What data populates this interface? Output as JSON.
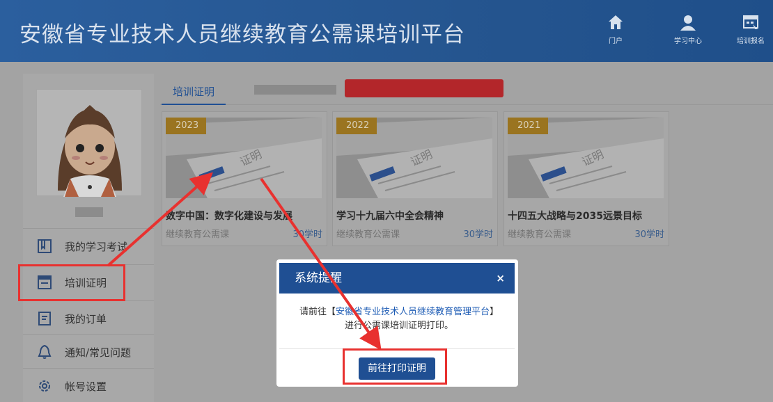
{
  "header": {
    "title": "安徽省专业技术人员继续教育公需课培训平台",
    "nav": [
      {
        "label": "门户",
        "icon": "home-icon"
      },
      {
        "label": "学习中心",
        "icon": "user-icon"
      },
      {
        "label": "培训报名",
        "icon": "signup-icon"
      }
    ]
  },
  "sidebar": {
    "items": [
      {
        "label": "我的学习考试",
        "icon": "book-icon"
      },
      {
        "label": "培训证明",
        "icon": "certificate-icon"
      },
      {
        "label": "我的订单",
        "icon": "order-icon"
      },
      {
        "label": "通知/常见问题",
        "icon": "bell-icon"
      },
      {
        "label": "帐号设置",
        "icon": "gear-icon"
      }
    ]
  },
  "tabs": {
    "active": "培训证明"
  },
  "cards": [
    {
      "year": "2023",
      "title": "数字中国：数字化建设与发展",
      "type": "继续教育公需课",
      "hours": "30学时"
    },
    {
      "year": "2022",
      "title": "学习十九届六中全会精神",
      "type": "继续教育公需课",
      "hours": "30学时"
    },
    {
      "year": "2021",
      "title": "十四五大战略与2035远景目标",
      "type": "继续教育公需课",
      "hours": "30学时"
    }
  ],
  "modal": {
    "title": "系统提醒",
    "close": "×",
    "msg_prefix": "请前往【",
    "msg_link": "安徽省专业技术人员继续教育管理平台",
    "msg_suffix": "】进行公需课培训证明打印。",
    "button": "前往打印证明"
  },
  "colors": {
    "brand": "#1f4f93",
    "highlight": "#e8312f",
    "year_badge": "#9a7420"
  }
}
